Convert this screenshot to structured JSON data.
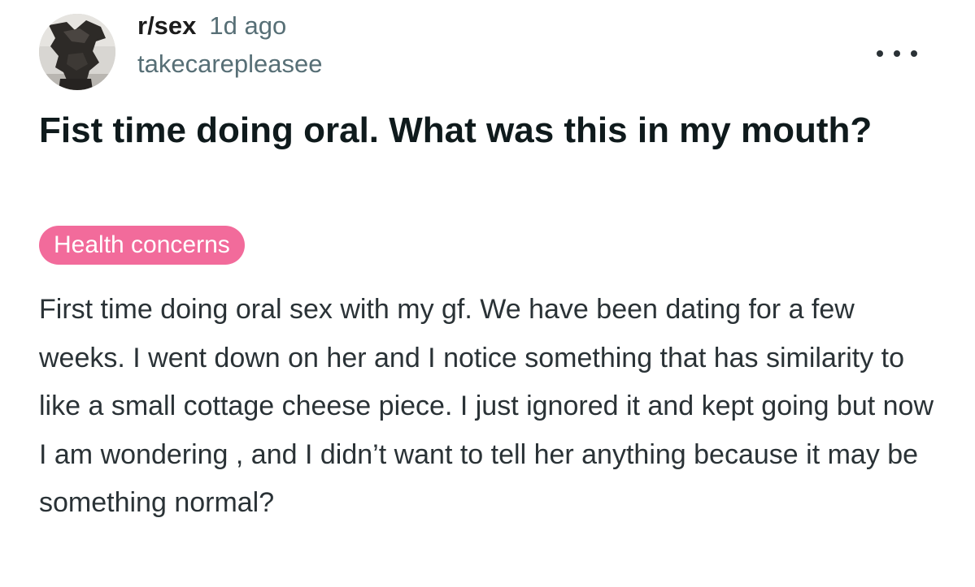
{
  "post": {
    "subreddit": "r/sex",
    "time_ago": "1d ago",
    "username": "takecarepleasee",
    "more_icon": "more-horizontal-icon",
    "title": "Fist time doing oral. What was this in my mouth?",
    "flair": "Health concerns",
    "body": "First time doing oral sex with my gf. We have been dating for a few weeks. I went down on her and I notice something that has similarity to like a small cottage cheese piece. I just ignored it and kept going but now I am wondering , and I didn’t want to tell her anything because it may be something normal?"
  },
  "colors": {
    "flair_background": "#f26b9b",
    "flair_text": "#ffffff",
    "meta_text": "#576f76",
    "title_text": "#0f1a1c",
    "body_text": "#2a3236"
  }
}
